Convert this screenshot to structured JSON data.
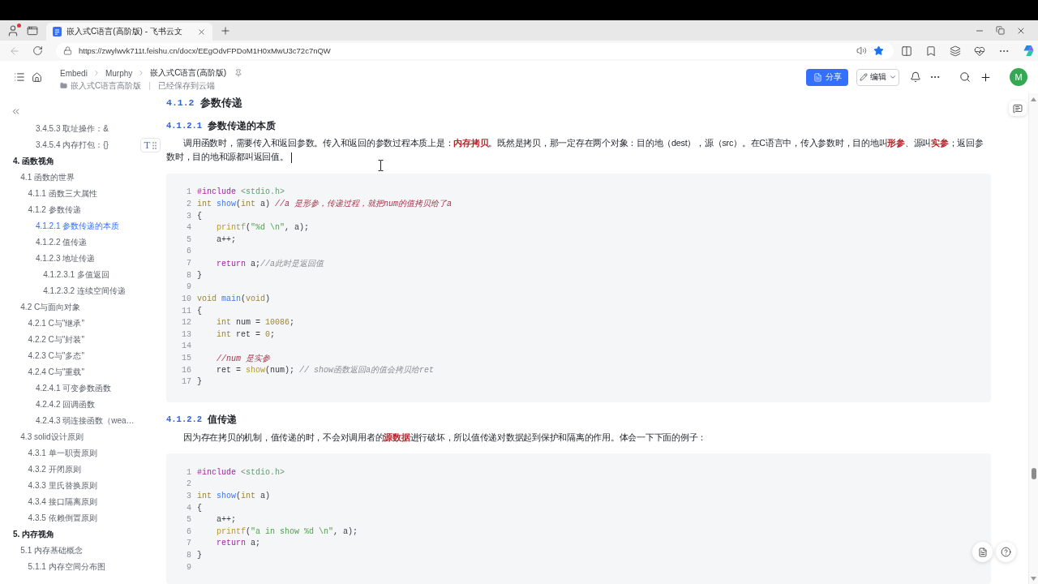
{
  "browser": {
    "tabs": [
      {
        "title": "嵌入式C语言(高阶版) - 飞书云文",
        "selected": true
      }
    ],
    "url": "https://zwylwvk711t.feishu.cn/docx/EEgOdvFPDoM1H0xMwU3c72c7nQW",
    "favorited": true
  },
  "doc_header": {
    "breadcrumb": [
      "Embedi",
      "Murphy",
      "嵌入式C语言(高阶版)"
    ],
    "folder": "嵌入式C语言高阶版",
    "save_status": "已经保存到云端",
    "share_button": "分享",
    "edit_button": "编辑",
    "avatar": "M"
  },
  "toc": [
    {
      "children": [
        {
          "children": [
            {
              "children": [
                {
                  "label": "3.4.5.3 取址操作：&",
                  "selected": false
                },
                {
                  "label": "3.4.5.4 内存打包：{}",
                  "selected": false
                }
              ]
            }
          ]
        }
      ]
    },
    {
      "label": "4. 函数视角",
      "selected": false,
      "children": [
        {
          "label": "4.1 函数的世界",
          "selected": false,
          "children": [
            {
              "label": "4.1.1 函数三大属性",
              "selected": false
            },
            {
              "label": "4.1.2 参数传递",
              "selected": false,
              "children": [
                {
                  "label": "4.1.2.1 参数传递的本质",
                  "selected": true
                },
                {
                  "label": "4.1.2.2 值传递",
                  "selected": false
                },
                {
                  "label": "4.1.2.3 地址传递",
                  "selected": false,
                  "children": [
                    {
                      "label": "4.1.2.3.1 多值返回",
                      "selected": false
                    },
                    {
                      "label": "4.1.2.3.2 连续空间传递",
                      "selected": false
                    }
                  ]
                }
              ]
            }
          ]
        },
        {
          "label": "4.2 C与面向对象",
          "selected": false,
          "children": [
            {
              "label": "4.2.1 C与\"继承\"",
              "selected": false
            },
            {
              "label": "4.2.2 C与\"封装\"",
              "selected": false
            },
            {
              "label": "4.2.3 C与\"多态\"",
              "selected": false
            },
            {
              "label": "4.2.4 C与\"重载\"",
              "selected": false,
              "children": [
                {
                  "label": "4.2.4.1 可变参数函数",
                  "selected": false
                },
                {
                  "label": "4.2.4.2 回调函数",
                  "selected": false
                },
                {
                  "label": "4.2.4.3 弱连接函数（wea…",
                  "selected": false
                }
              ]
            }
          ]
        },
        {
          "label": "4.3 solid设计原则",
          "selected": false,
          "children": [
            {
              "label": "4.3.1 单一职责原则",
              "selected": false
            },
            {
              "label": "4.3.2 开闭原则",
              "selected": false
            },
            {
              "label": "4.3.3 里氏替换原则",
              "selected": false
            },
            {
              "label": "4.3.4 接口隔离原则",
              "selected": false
            },
            {
              "label": "4.3.5 依赖倒置原则",
              "selected": false
            }
          ]
        }
      ]
    },
    {
      "label": "5. 内存视角",
      "selected": false,
      "children": [
        {
          "label": "5.1 内存基础概念",
          "selected": false,
          "children": [
            {
              "label": "5.1.1 内存空间分布图",
              "selected": false
            }
          ]
        }
      ]
    }
  ],
  "block_handle": {
    "label": "T"
  },
  "content": [
    {
      "kind": "section",
      "number": "4.1.2",
      "title": "参数传递"
    },
    {
      "kind": "subsection",
      "number": "4.1.2.1",
      "title": "参数传递的本质"
    },
    {
      "kind": "paragraph",
      "text": "调用函数时，需要传入和返回参数。传入和返回的参数过程本质上是：**内存拷贝**。既然是拷贝，那一定存在两个对象：目的地（dest），源（src）。在C语言中，传入参数时，目的地叫**形参**、源叫**实参**；返回参数时，目的地和源都叫返回值。",
      "cursor": true
    },
    {
      "kind": "code",
      "lines": [
        {
          "number": "1",
          "tokens": [
            {
              "kind": "directive",
              "text": "#include "
            },
            {
              "kind": "header",
              "text": "<stdio.h>"
            }
          ]
        },
        {
          "number": "2",
          "tokens": [
            {
              "kind": "type",
              "text": "int "
            },
            {
              "kind": "definition",
              "text": "show"
            },
            {
              "kind": "plain",
              "text": "("
            },
            {
              "kind": "type",
              "text": "int"
            },
            {
              "kind": "plain",
              "text": " a) "
            },
            {
              "kind": "remark",
              "text": "//a 是形参，传递过程，就把num的值拷贝给了a"
            }
          ]
        },
        {
          "number": "3",
          "tokens": [
            {
              "kind": "plain",
              "text": "{"
            }
          ]
        },
        {
          "number": "4",
          "tokens": [
            {
              "kind": "call",
              "text": "    printf"
            },
            {
              "kind": "plain",
              "text": "("
            },
            {
              "kind": "string",
              "text": "\"%d \\n\""
            },
            {
              "kind": "plain",
              "text": ", a);"
            }
          ]
        },
        {
          "number": "5",
          "tokens": [
            {
              "kind": "plain",
              "text": "    a++;"
            }
          ]
        },
        {
          "number": "6"
        },
        {
          "number": "7",
          "tokens": [
            {
              "kind": "keyword",
              "text": "    return"
            },
            {
              "kind": "plain",
              "text": " a;"
            },
            {
              "kind": "comment",
              "text": "//a此时是返回值"
            }
          ]
        },
        {
          "number": "8",
          "tokens": [
            {
              "kind": "plain",
              "text": "}"
            }
          ]
        },
        {
          "number": "9"
        },
        {
          "number": "10",
          "tokens": [
            {
              "kind": "type",
              "text": "void "
            },
            {
              "kind": "definition",
              "text": "main"
            },
            {
              "kind": "plain",
              "text": "("
            },
            {
              "kind": "type",
              "text": "void"
            },
            {
              "kind": "plain",
              "text": ")"
            }
          ]
        },
        {
          "number": "11",
          "tokens": [
            {
              "kind": "plain",
              "text": "{"
            }
          ]
        },
        {
          "number": "12",
          "tokens": [
            {
              "kind": "type",
              "text": "    int"
            },
            {
              "kind": "plain",
              "text": " num = "
            },
            {
              "kind": "number",
              "text": "10086"
            },
            {
              "kind": "plain",
              "text": ";"
            }
          ]
        },
        {
          "number": "13",
          "tokens": [
            {
              "kind": "type",
              "text": "    int"
            },
            {
              "kind": "plain",
              "text": " ret = "
            },
            {
              "kind": "number",
              "text": "0"
            },
            {
              "kind": "plain",
              "text": ";"
            }
          ]
        },
        {
          "number": "14"
        },
        {
          "number": "15",
          "tokens": [
            {
              "kind": "remark",
              "text": "    //num 是实参"
            }
          ]
        },
        {
          "number": "16",
          "tokens": [
            {
              "kind": "plain",
              "text": "    ret = "
            },
            {
              "kind": "call",
              "text": "show"
            },
            {
              "kind": "plain",
              "text": "(num); "
            },
            {
              "kind": "comment",
              "text": "// show函数返回a的值会拷贝给ret"
            }
          ]
        },
        {
          "number": "17",
          "tokens": [
            {
              "kind": "plain",
              "text": "}"
            }
          ]
        }
      ]
    },
    {
      "kind": "subsection",
      "number": "4.1.2.2",
      "title": "值传递"
    },
    {
      "kind": "paragraph",
      "text": "因为存在拷贝的机制，值传递的时，不会对调用者的**源数据**进行破坏，所以值传递对数据起到保护和隔离的作用。体会一下下面的例子："
    },
    {
      "kind": "code",
      "lines": [
        {
          "number": "1",
          "tokens": [
            {
              "kind": "directive",
              "text": "#include "
            },
            {
              "kind": "header",
              "text": "<stdio.h>"
            }
          ]
        },
        {
          "number": "2"
        },
        {
          "number": "3",
          "tokens": [
            {
              "kind": "type",
              "text": "int "
            },
            {
              "kind": "definition",
              "text": "show"
            },
            {
              "kind": "plain",
              "text": "("
            },
            {
              "kind": "type",
              "text": "int"
            },
            {
              "kind": "plain",
              "text": " a)"
            }
          ]
        },
        {
          "number": "4",
          "tokens": [
            {
              "kind": "plain",
              "text": "{"
            }
          ]
        },
        {
          "number": "5",
          "tokens": [
            {
              "kind": "plain",
              "text": "    a++;"
            }
          ]
        },
        {
          "number": "6",
          "tokens": [
            {
              "kind": "call",
              "text": "    printf"
            },
            {
              "kind": "plain",
              "text": "("
            },
            {
              "kind": "string",
              "text": "\"a in show %d \\n\""
            },
            {
              "kind": "plain",
              "text": ", a);"
            }
          ]
        },
        {
          "number": "7",
          "tokens": [
            {
              "kind": "keyword",
              "text": "    return"
            },
            {
              "kind": "plain",
              "text": " a;"
            }
          ]
        },
        {
          "number": "8",
          "tokens": [
            {
              "kind": "plain",
              "text": "}"
            }
          ]
        },
        {
          "number": "9"
        }
      ]
    }
  ]
}
